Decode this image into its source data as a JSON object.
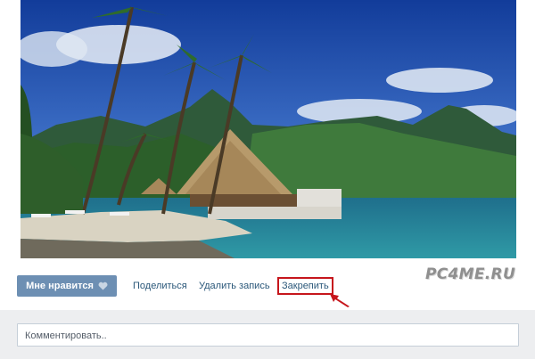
{
  "post": {
    "image_alt": "Tropical beach resort with palm trees, thatched bungalow, lagoon and mountains"
  },
  "actions": {
    "like_label": "Мне нравится",
    "share_label": "Поделиться",
    "delete_label": "Удалить запись",
    "pin_label": "Закрепить"
  },
  "watermark": "PC4ME.RU",
  "comment": {
    "placeholder": "Комментировать.."
  },
  "colors": {
    "like_button": "#6d8fb3",
    "link": "#2b587a",
    "highlight": "#c6161c",
    "comment_bg": "#edeef0"
  }
}
